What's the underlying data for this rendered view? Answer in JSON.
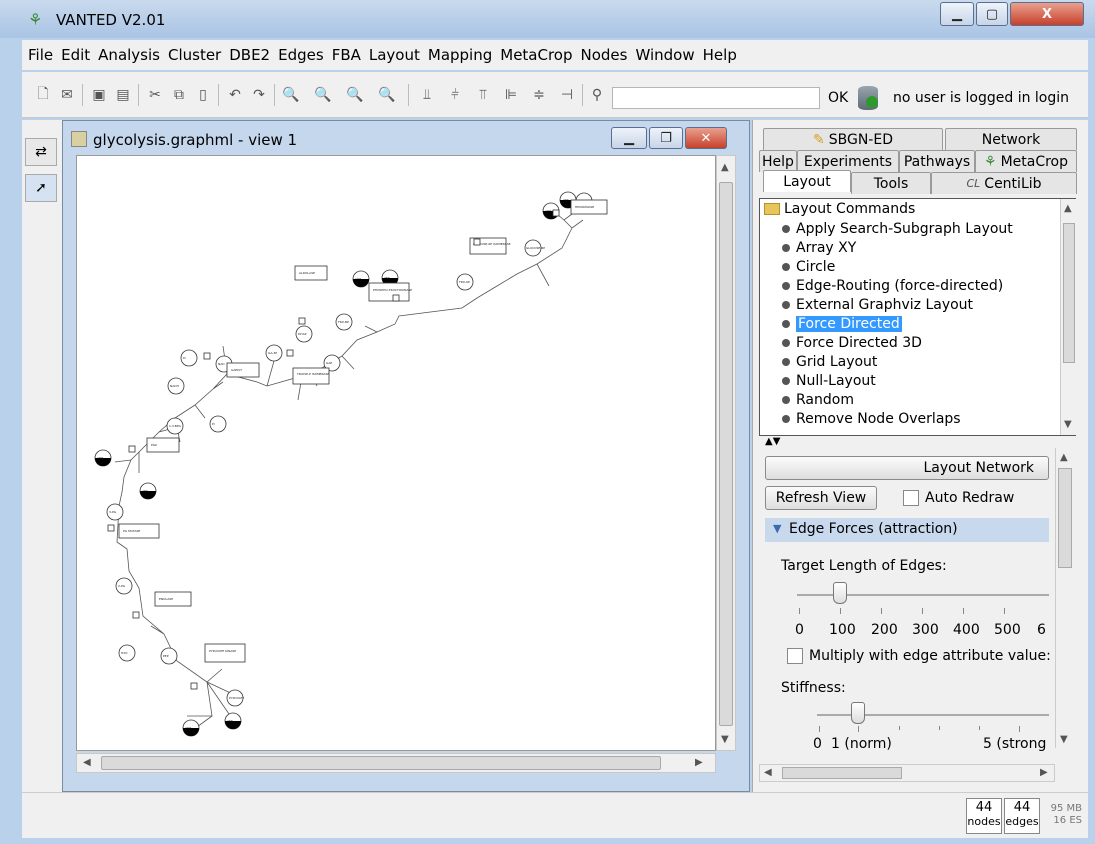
{
  "window": {
    "title": "VANTED V2.01"
  },
  "menu": [
    "File",
    "Edit",
    "Analysis",
    "Cluster",
    "DBE2",
    "Edges",
    "FBA",
    "Layout",
    "Mapping",
    "MetaCrop",
    "Nodes",
    "Window",
    "Help"
  ],
  "toolbar": {
    "ok_label": "OK",
    "login_status": "no user is logged in",
    "login_label": "login",
    "search_value": ""
  },
  "graph_window": {
    "title": "glycolysis.graphml - view 1"
  },
  "right_panel": {
    "tabs_row1": [
      "SBGN-ED",
      "Network"
    ],
    "tabs_row2": [
      "Help",
      "Experiments",
      "Pathways",
      "MetaCrop"
    ],
    "tabs_row3": [
      "Layout",
      "Tools",
      "CentiLib"
    ],
    "tree": {
      "root": "Layout Commands",
      "items": [
        "Apply Search-Subgraph Layout",
        "Array XY",
        "Circle",
        "Edge-Routing (force-directed)",
        "External Graphviz Layout",
        "Force Directed",
        "Force Directed 3D",
        "Grid Layout",
        "Null-Layout",
        "Random",
        "Remove Node Overlaps"
      ],
      "selected": "Force Directed"
    },
    "layout_network_label": "Layout Network",
    "refresh_view_label": "Refresh View",
    "auto_redraw_label": "Auto Redraw",
    "auto_redraw_checked": false,
    "section_title": "Edge Forces (attraction)",
    "target_length_label": "Target Length of Edges:",
    "target_length_value": 100,
    "target_length_ticks": [
      "0",
      "100",
      "200",
      "300",
      "400",
      "500",
      "6"
    ],
    "multiply_label": "Multiply with edge attribute value:",
    "multiply_checked": false,
    "stiffness_label": "Stiffness:",
    "stiffness_value": 1,
    "stiffness_ticks": [
      "0",
      "1 (norm)",
      "5 (strong"
    ]
  },
  "status": {
    "nodes_count": "44",
    "nodes_label": "nodes",
    "edges_count": "44",
    "edges_label": "edges",
    "memory": "95 MB",
    "memory2": "16 ES"
  },
  "icons": [
    "vanted-leaf-icon",
    "minimize-icon",
    "maximize-icon",
    "close-icon",
    "new-file-icon",
    "open-icon",
    "save-icon",
    "cut-icon",
    "copy-icon",
    "paste-icon",
    "undo-icon",
    "redo-icon",
    "zoom-out-icon",
    "zoom-in-icon",
    "zoom-fit-icon",
    "zoom-reset-icon",
    "align-icon",
    "search-icon",
    "database-icon",
    "pencil-icon",
    "folder-icon"
  ]
}
